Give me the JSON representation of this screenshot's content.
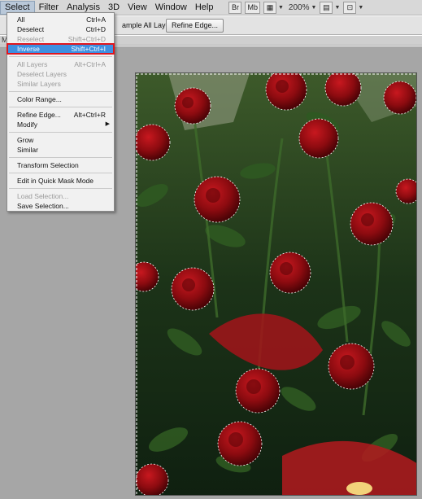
{
  "menubar": {
    "items": [
      "Select",
      "Filter",
      "Analysis",
      "3D",
      "View",
      "Window",
      "Help"
    ],
    "active": "Select",
    "toolbar": {
      "br_icon": "Br",
      "mb_icon": "Mb",
      "zoom": "200%"
    }
  },
  "options_bar": {
    "sample_all_layers": "ample All Layers",
    "refine_edge_button": "Refine Edge..."
  },
  "tabstrip": {
    "label": "M"
  },
  "select_menu": {
    "groups": [
      [
        {
          "label": "All",
          "shortcut": "Ctrl+A",
          "enabled": true
        },
        {
          "label": "Deselect",
          "shortcut": "Ctrl+D",
          "enabled": true
        },
        {
          "label": "Reselect",
          "shortcut": "Shift+Ctrl+D",
          "enabled": false
        },
        {
          "label": "Inverse",
          "shortcut": "Shift+Ctrl+I",
          "enabled": true,
          "highlighted": true
        }
      ],
      [
        {
          "label": "All Layers",
          "shortcut": "Alt+Ctrl+A",
          "enabled": false
        },
        {
          "label": "Deselect Layers",
          "shortcut": "",
          "enabled": false
        },
        {
          "label": "Similar Layers",
          "shortcut": "",
          "enabled": false
        }
      ],
      [
        {
          "label": "Color Range...",
          "shortcut": "",
          "enabled": true
        }
      ],
      [
        {
          "label": "Refine Edge...",
          "shortcut": "Alt+Ctrl+R",
          "enabled": true
        },
        {
          "label": "Modify",
          "shortcut": "",
          "enabled": true,
          "submenu": true
        }
      ],
      [
        {
          "label": "Grow",
          "shortcut": "",
          "enabled": true
        },
        {
          "label": "Similar",
          "shortcut": "",
          "enabled": true
        }
      ],
      [
        {
          "label": "Transform Selection",
          "shortcut": "",
          "enabled": true
        }
      ],
      [
        {
          "label": "Edit in Quick Mask Mode",
          "shortcut": "",
          "enabled": true
        }
      ],
      [
        {
          "label": "Load Selection...",
          "shortcut": "",
          "enabled": false
        },
        {
          "label": "Save Selection...",
          "shortcut": "",
          "enabled": true
        }
      ]
    ]
  },
  "canvas": {
    "content": "red-roses-photo",
    "colors": {
      "foliage": "#1f3a1a",
      "rose": "#9c0f14",
      "rose_dark": "#5e0508",
      "highlight": "#3d8fe0",
      "outline": "#e0161e"
    }
  }
}
